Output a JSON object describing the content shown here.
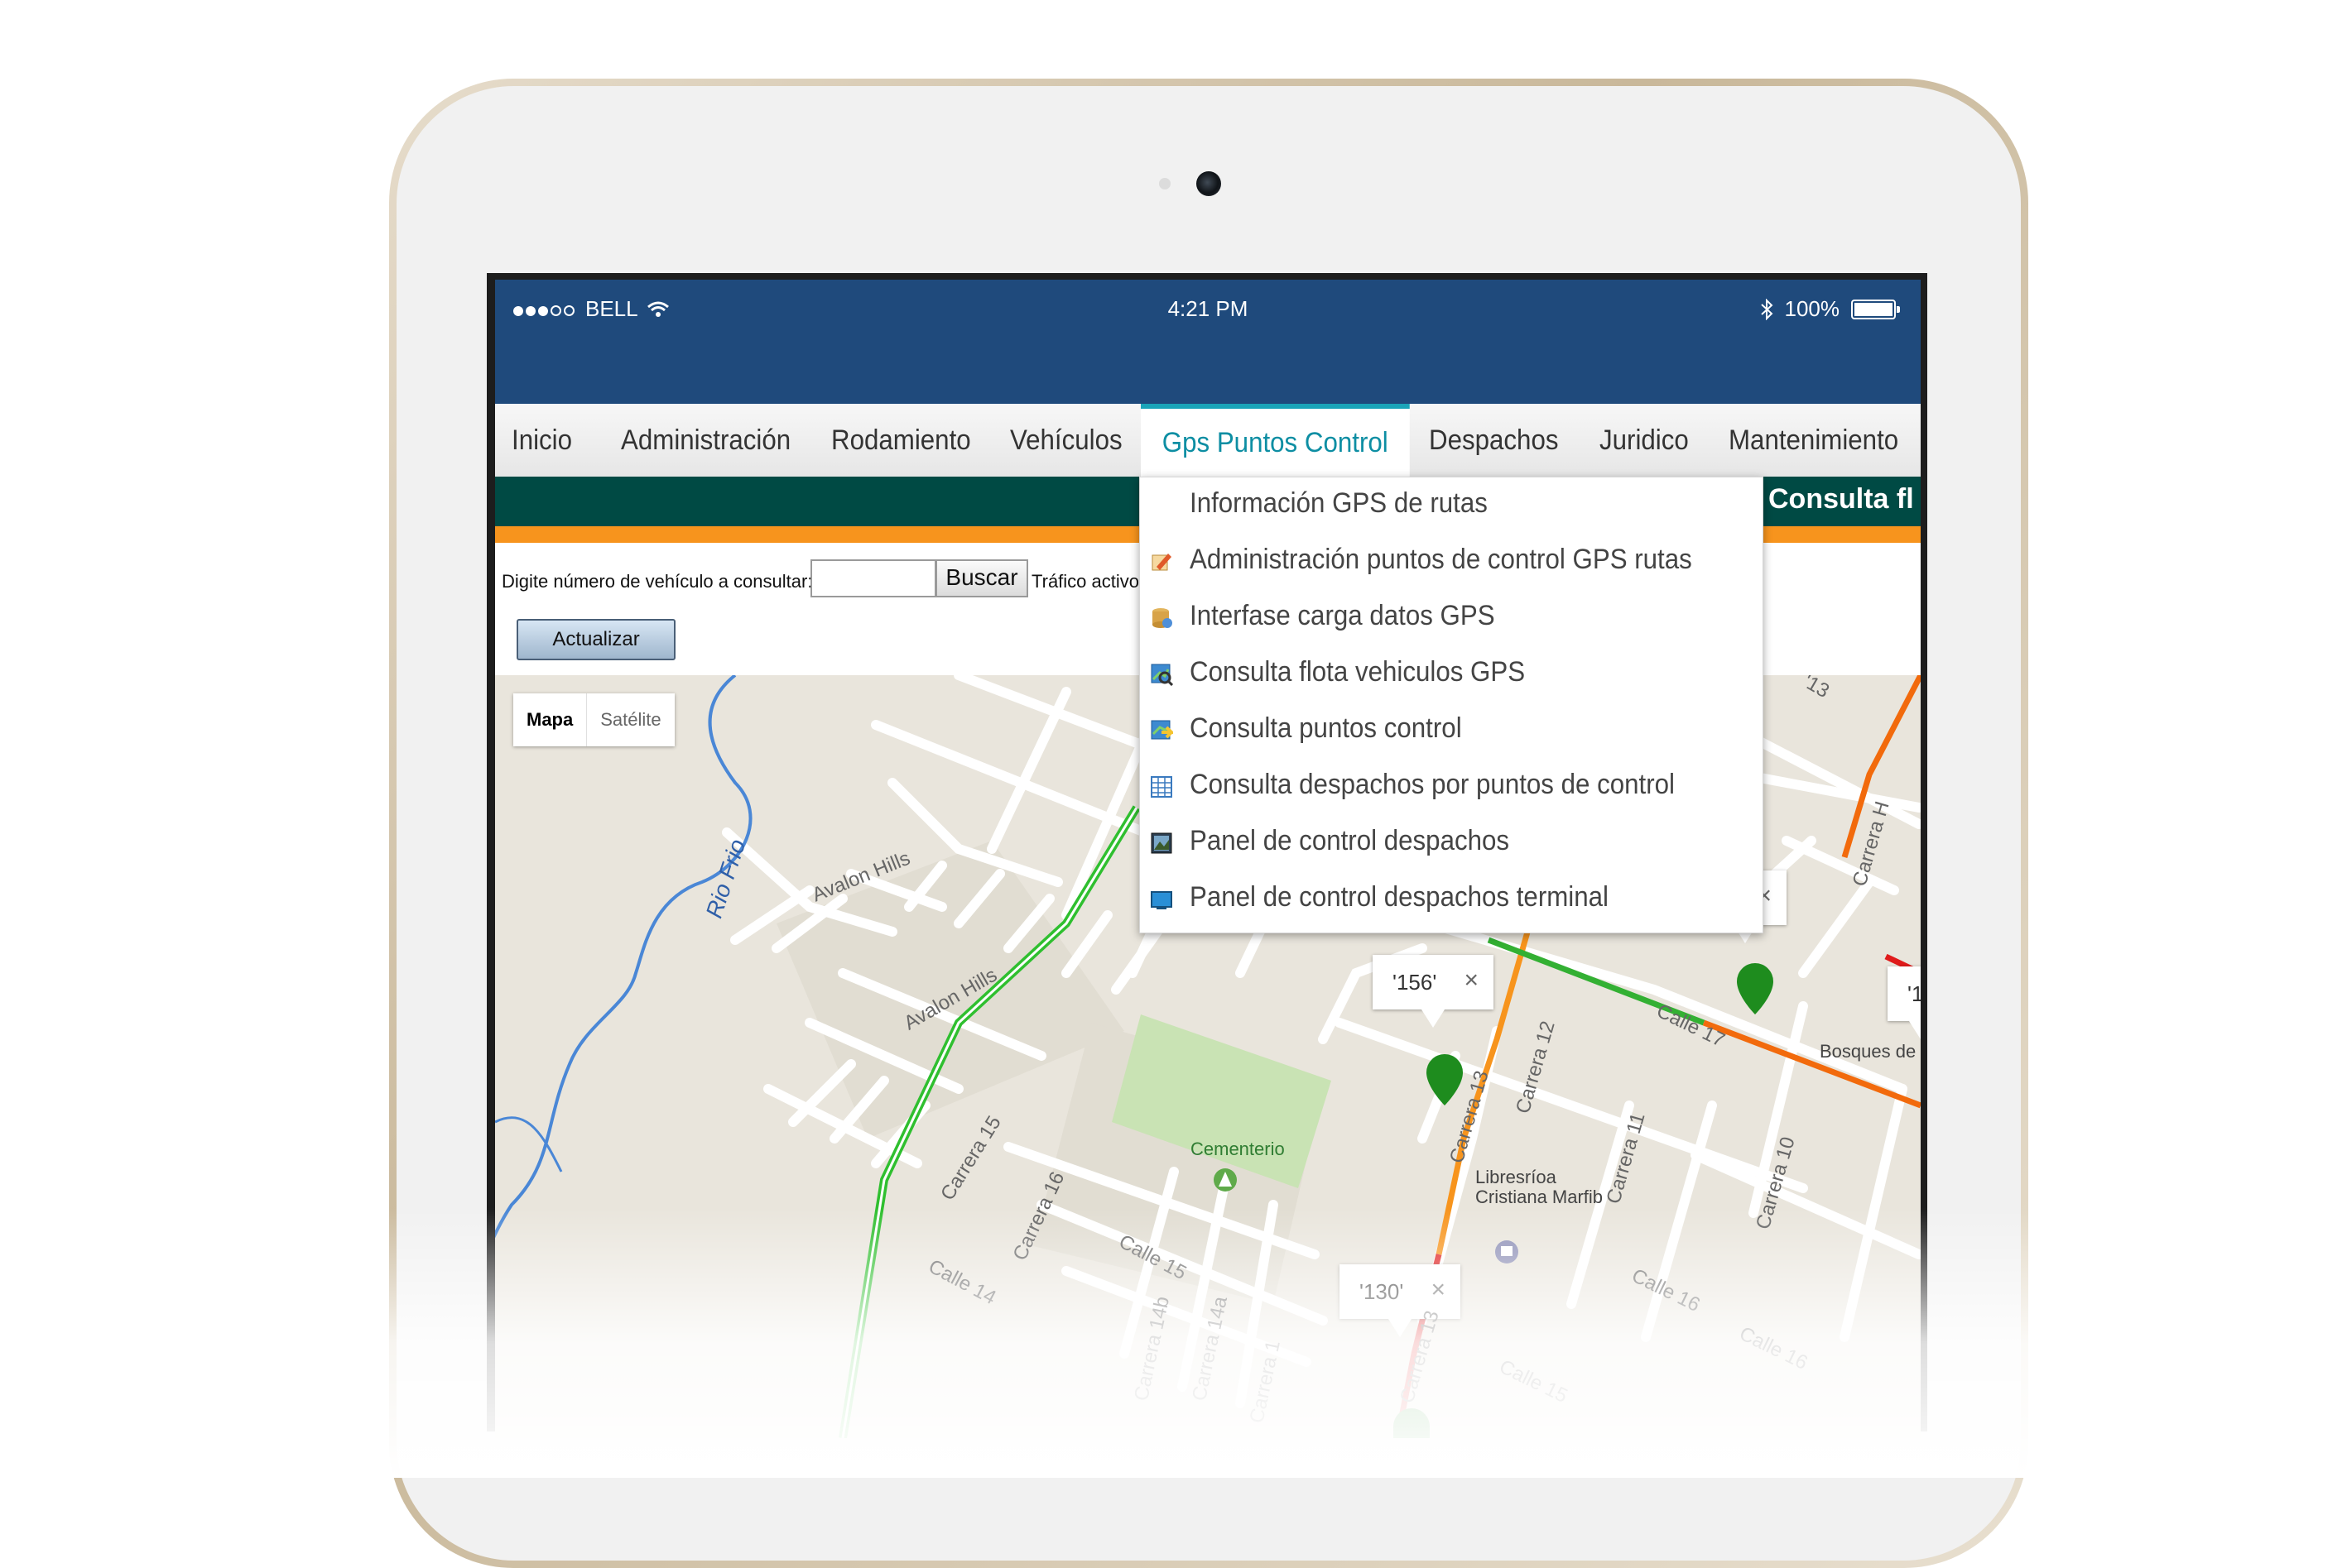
{
  "status_bar": {
    "carrier": "BELL",
    "time": "4:21 PM",
    "battery": "100%"
  },
  "nav": {
    "items": [
      {
        "label": "Inicio"
      },
      {
        "label": "Administración"
      },
      {
        "label": "Rodamiento"
      },
      {
        "label": "Vehículos"
      },
      {
        "label": "Gps Puntos Control",
        "active": true
      },
      {
        "label": "Despachos"
      },
      {
        "label": "Juridico"
      },
      {
        "label": "Mantenimiento"
      }
    ]
  },
  "dropdown": {
    "items": [
      {
        "label": "Información GPS de rutas",
        "icon": "none"
      },
      {
        "label": "Administración puntos de control GPS rutas",
        "icon": "edit-pencil-icon"
      },
      {
        "label": "Interfase carga datos GPS",
        "icon": "database-icon"
      },
      {
        "label": "Consulta flota vehiculos GPS",
        "icon": "map-search-icon"
      },
      {
        "label": "Consulta puntos control",
        "icon": "map-arrow-icon"
      },
      {
        "label": "Consulta despachos por puntos de control",
        "icon": "table-grid-icon"
      },
      {
        "label": "Panel de control despachos",
        "icon": "panel-image-icon"
      },
      {
        "label": "Panel de control despachos terminal",
        "icon": "monitor-icon"
      }
    ]
  },
  "page": {
    "title": "Consulta fl",
    "search_label": "Digite número de vehículo a consultar:",
    "search_value": "",
    "search_button": "Buscar",
    "traffic_label": "Tráfico activo",
    "update_button": "Actualizar"
  },
  "map": {
    "type_options": {
      "map": "Mapa",
      "satellite": "Satélite"
    },
    "markers": [
      {
        "label": "'156'",
        "close": "×"
      },
      {
        "label": "'130'",
        "close": "×"
      },
      {
        "label": "",
        "close": "×"
      },
      {
        "label": "'1",
        "close": ""
      }
    ],
    "labels": {
      "river": "Rio Frio",
      "avalon1": "Avalon Hills",
      "avalon2": "Avalon Hills",
      "carrera15": "Carrera 15",
      "carrera16": "Carrera 16",
      "carrera14b": "Carrera 14b",
      "carrera14a": "Carrera 14a",
      "carrera13a": "Carrera 13",
      "carrera13b": "Carrera 13",
      "carrera12": "Carrera 12",
      "carrera11": "Carrera 11",
      "carrera10": "Carrera 10",
      "carrera1x": "Carrera 1",
      "carrera_h": "Carrera H",
      "calle14": "Calle 14",
      "calle15a": "Calle 15",
      "calle15b": "Calle 15",
      "calle16a": "Calle 16",
      "calle16b": "Calle 16",
      "calle17": "Calle 17",
      "calle13": "'13",
      "c_small": "C",
      "bosques": "Bosques de S",
      "cementerio": "Cementerio",
      "libreria1": "Libresríoa",
      "libreria2": "Cristiana Marfib"
    }
  },
  "colors": {
    "header": "#1f4a7c",
    "band": "#004a44",
    "orange": "#f7941d",
    "active_tab": "#0d8ea3",
    "marker": "#1e8c1e"
  }
}
